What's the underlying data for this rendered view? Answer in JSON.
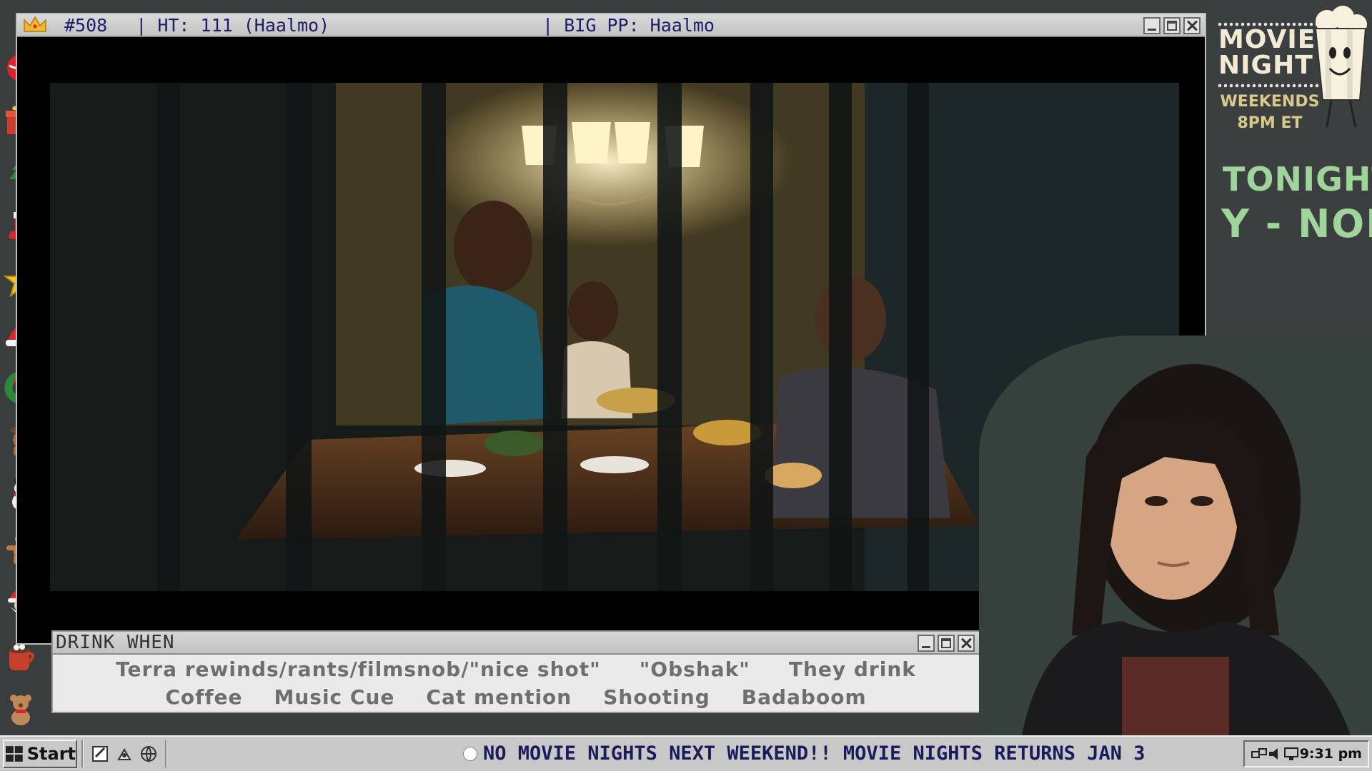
{
  "video_window": {
    "title_number": "#508",
    "title_ht": "| HT: 111 (Haalmo)",
    "title_bigpp": "| BIG PP: Haalmo"
  },
  "drink_window": {
    "title": "DRINK WHEN",
    "row1": [
      "Terra rewinds/rants/filmsnob/\"nice shot\"",
      "\"Obshak\"",
      "They drink"
    ],
    "row2": [
      "Coffee",
      "Music Cue",
      "Cat mention",
      "Shooting",
      "Badaboom"
    ]
  },
  "sidebar": {
    "logo_line1": "MOVIE",
    "logo_line2": "NIGHT",
    "schedule_line1": "WEEKENDS",
    "schedule_line2": "8PM ET",
    "tonight_label": "TONIGHT:",
    "tonight_title": "Y - NOB"
  },
  "left_rail_icons": [
    "ornament-icon",
    "gift-icon",
    "christmas-tree-icon",
    "stocking-icon",
    "star-icon",
    "santa-hat-icon",
    "wreath-icon",
    "reindeer-icon",
    "snowman-icon",
    "gingerbread-man-icon",
    "santa-icon",
    "hot-cocoa-icon",
    "teddy-bear-icon"
  ],
  "taskbar": {
    "start_label": "Start",
    "ticker": "NO MOVIE NIGHTS NEXT WEEKEND!! MOVIE NIGHTS RETURNS JAN 3",
    "clock": "9:31 pm"
  },
  "colors": {
    "title_text": "#1d1d6a",
    "accent_green": "#9fd49a",
    "taskbar": "#c8c8c8"
  }
}
